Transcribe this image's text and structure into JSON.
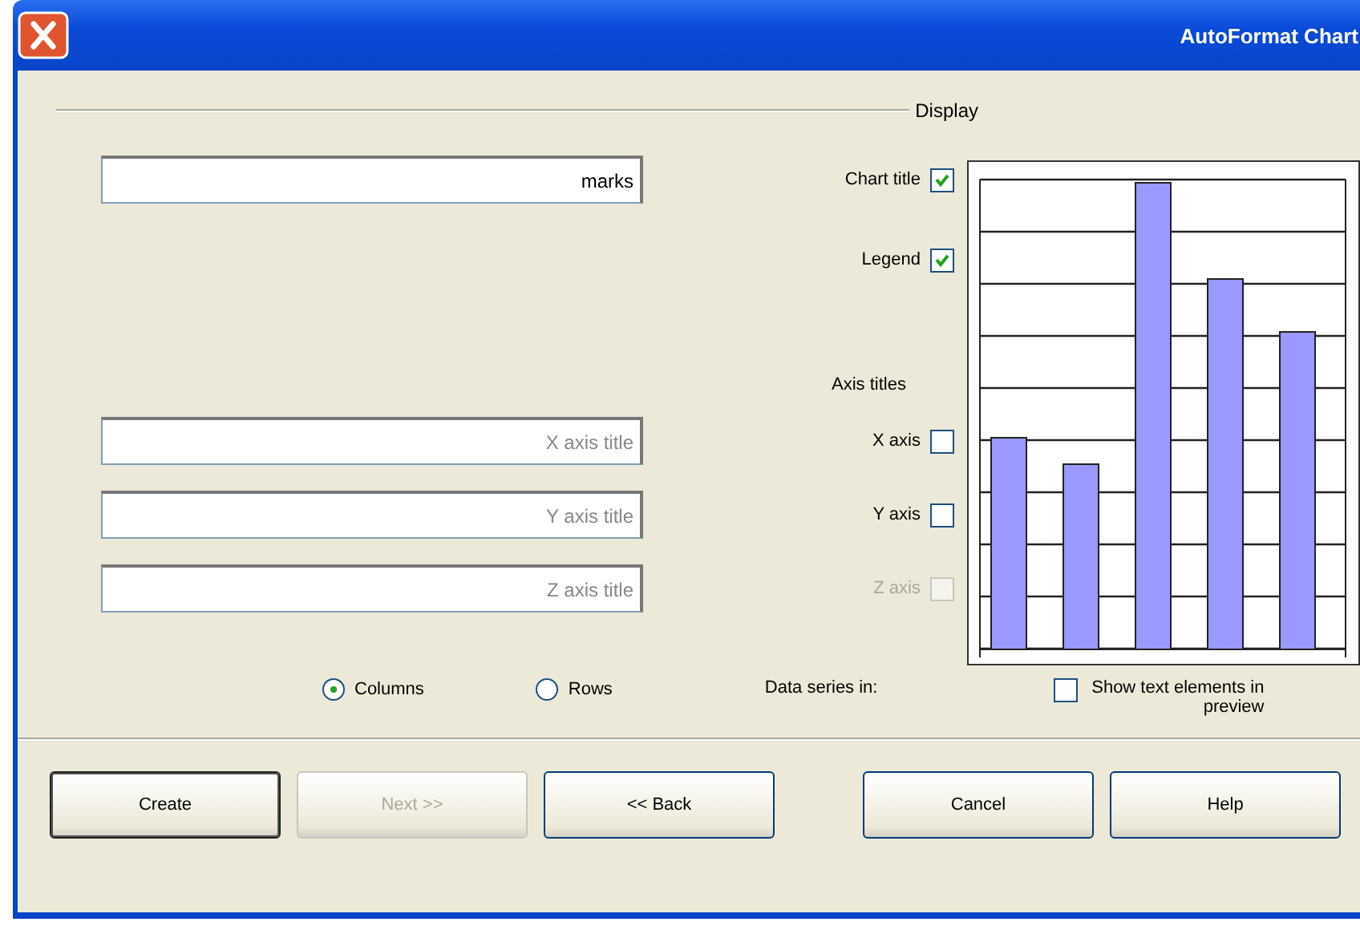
{
  "window": {
    "title": "AutoFormat Chart"
  },
  "display": {
    "label": "Display",
    "options": [
      {
        "label": "Chart title",
        "checked": true,
        "value": "marks"
      },
      {
        "label": "Legend",
        "checked": true
      }
    ]
  },
  "axis_titles": {
    "label": "Axis titles",
    "axes": [
      {
        "label": "X axis",
        "checked": false,
        "disabled": false,
        "placeholder": "X axis title"
      },
      {
        "label": "Y axis",
        "checked": false,
        "disabled": false,
        "placeholder": "Y axis title"
      },
      {
        "label": "Z axis",
        "checked": false,
        "disabled": true,
        "placeholder": "Z axis title"
      }
    ]
  },
  "preview_option": {
    "label": "Show text elements in preview",
    "checked": false
  },
  "data_series": {
    "label": "Data series in:",
    "options": [
      {
        "label": "Columns",
        "selected": true
      },
      {
        "label": "Rows",
        "selected": false
      }
    ]
  },
  "buttons": [
    {
      "label": "Create",
      "disabled": false,
      "default": true
    },
    {
      "label": "Next >>",
      "disabled": true,
      "default": false
    },
    {
      "label": "<< Back",
      "disabled": false,
      "default": false
    },
    {
      "label": "Cancel",
      "disabled": false,
      "default": false
    },
    {
      "label": "Help",
      "disabled": false,
      "default": false
    }
  ]
}
